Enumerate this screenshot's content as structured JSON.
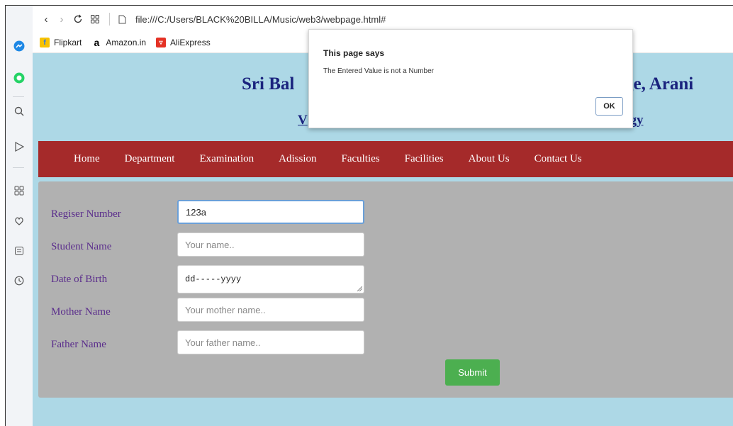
{
  "browser": {
    "url": "file:///C:/Users/BLACK%20BILLA/Music/web3/webpage.html#",
    "bookmarks": [
      {
        "label": "Flipkart",
        "icon": "flipkart-icon",
        "color": "#2874f0"
      },
      {
        "label": "Amazon.in",
        "icon": "amazon-icon",
        "color": "#000000"
      },
      {
        "label": "AliExpress",
        "icon": "aliexpress-icon",
        "color": "#e43225"
      }
    ]
  },
  "page": {
    "title_left": "Sri Bal",
    "title_right": "ge, Arani",
    "subtitle_left": "V",
    "subtitle_right": "ogy",
    "nav": [
      "Home",
      "Department",
      "Examination",
      "Adission",
      "Faculties",
      "Facilities",
      "About Us",
      "Contact Us"
    ],
    "form": {
      "register_label": "Regiser Number",
      "register_value": "123a",
      "name_label": "Student Name",
      "name_placeholder": "Your name..",
      "dob_label": "Date of Birth",
      "dob_value": "dd-----yyyy",
      "mother_label": "Mother Name",
      "mother_placeholder": "Your mother name..",
      "father_label": "Father Name",
      "father_placeholder": "Your father name..",
      "submit_label": "Submit"
    }
  },
  "dialog": {
    "title": "This page says",
    "message": "The Entered Value is not a Number",
    "ok_label": "OK"
  },
  "colors": {
    "nav_bg": "#a52a2a",
    "page_bg": "#add8e6",
    "form_bg": "#b1b1b1",
    "submit_bg": "#4caf50",
    "title_color": "#1a237e"
  }
}
